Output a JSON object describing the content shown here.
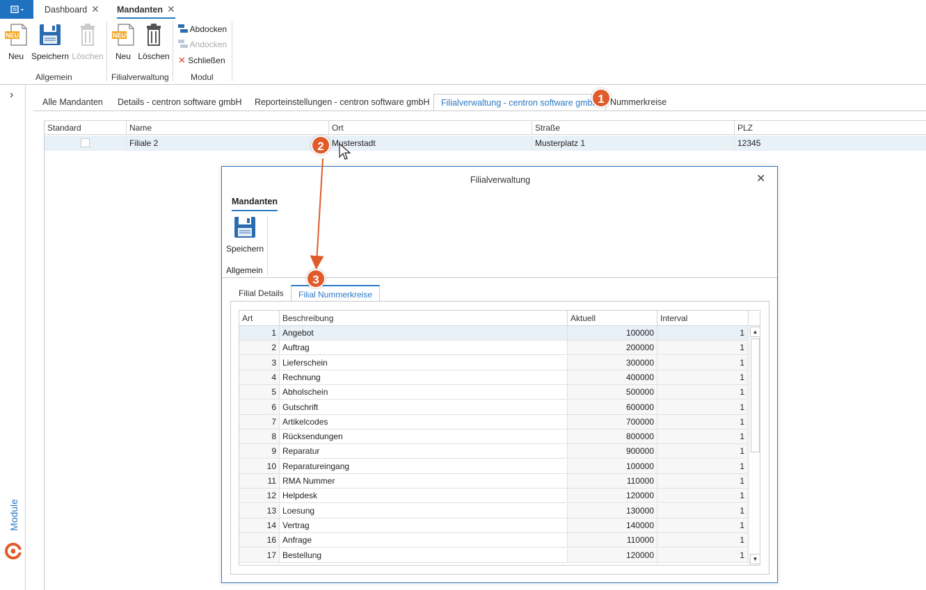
{
  "top_tabs": [
    {
      "label": "Dashboard",
      "active": false
    },
    {
      "label": "Mandanten",
      "active": true
    }
  ],
  "ribbon": {
    "allgemein": {
      "label": "Allgemein",
      "new_label": "Neu",
      "save_label": "Speichern",
      "delete_label": "Löschen"
    },
    "filialverwaltung": {
      "label": "Filialverwaltung",
      "new_label": "Neu",
      "delete_label": "Löschen"
    },
    "modul": {
      "label": "Modul",
      "abdocken_label": "Abdocken",
      "andocken_label": "Andocken",
      "close_label": "Schließen"
    },
    "new_badge": "NEU"
  },
  "sidebar": {
    "expand_glyph": "›",
    "module_label": "Module"
  },
  "main_tabs": [
    "Alle Mandanten",
    "Details - centron software gmbH",
    "Reporteinstellungen - centron software gmbH",
    "Filialverwaltung - centron software gmbH",
    "Nummerkreise"
  ],
  "grid": {
    "headers": [
      "Standard",
      "Name",
      "Ort",
      "Straße",
      "PLZ"
    ],
    "row": {
      "name": "Filiale 2",
      "ort": "Musterstadt",
      "strasse": "Musterplatz 1",
      "plz": "12345"
    }
  },
  "dialog": {
    "title": "Filialverwaltung",
    "ribbon_tab": "Mandanten",
    "save_label": "Speichern",
    "group_label": "Allgemein",
    "tabs": [
      "Filial Details",
      "Filial Nummerkreise"
    ],
    "table": {
      "headers": [
        "Art",
        "Beschreibung",
        "Aktuell",
        "Interval"
      ],
      "rows": [
        {
          "art": "1",
          "desc": "Angebot",
          "akt": "100000",
          "int": "1"
        },
        {
          "art": "2",
          "desc": "Auftrag",
          "akt": "200000",
          "int": "1"
        },
        {
          "art": "3",
          "desc": "Lieferschein",
          "akt": "300000",
          "int": "1"
        },
        {
          "art": "4",
          "desc": "Rechnung",
          "akt": "400000",
          "int": "1"
        },
        {
          "art": "5",
          "desc": "Abholschein",
          "akt": "500000",
          "int": "1"
        },
        {
          "art": "6",
          "desc": "Gutschrift",
          "akt": "600000",
          "int": "1"
        },
        {
          "art": "7",
          "desc": "Artikelcodes",
          "akt": "700000",
          "int": "1"
        },
        {
          "art": "8",
          "desc": "Rücksendungen",
          "akt": "800000",
          "int": "1"
        },
        {
          "art": "9",
          "desc": "Reparatur",
          "akt": "900000",
          "int": "1"
        },
        {
          "art": "10",
          "desc": "Reparatureingang",
          "akt": "100000",
          "int": "1"
        },
        {
          "art": "11",
          "desc": "RMA Nummer",
          "akt": "110000",
          "int": "1"
        },
        {
          "art": "12",
          "desc": "Helpdesk",
          "akt": "120000",
          "int": "1"
        },
        {
          "art": "13",
          "desc": "Loesung",
          "akt": "130000",
          "int": "1"
        },
        {
          "art": "14",
          "desc": "Vertrag",
          "akt": "140000",
          "int": "1"
        },
        {
          "art": "16",
          "desc": "Anfrage",
          "akt": "110000",
          "int": "1"
        },
        {
          "art": "17",
          "desc": "Bestellung",
          "akt": "120000",
          "int": "1"
        }
      ]
    }
  },
  "badges": [
    "1",
    "2",
    "3"
  ],
  "colors": {
    "accent": "#2b78c4",
    "badge": "#e05a2a",
    "module_logo": "#e05a2a"
  }
}
